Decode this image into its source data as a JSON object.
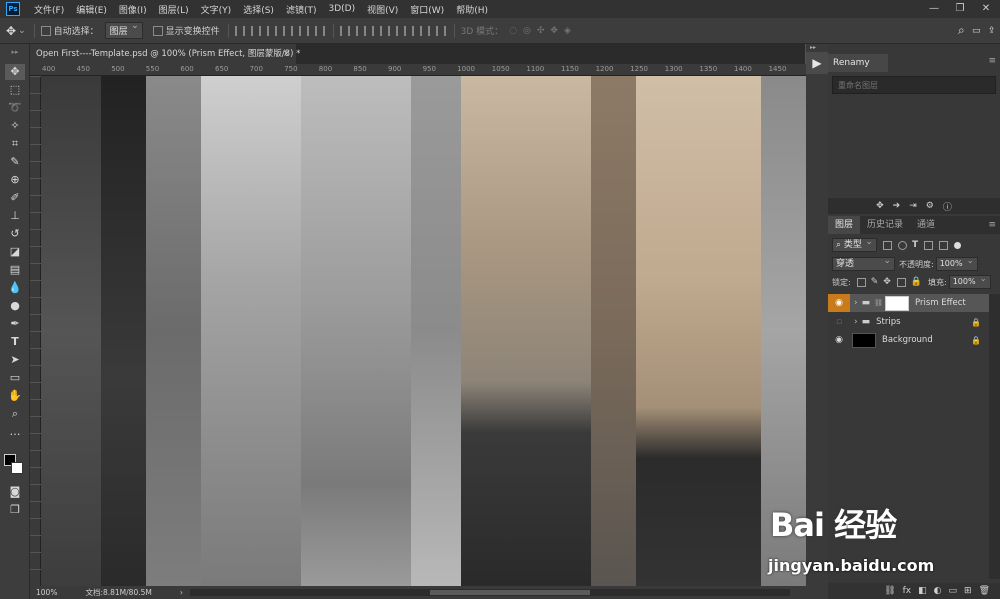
{
  "app": {
    "logo": "Ps"
  },
  "menu": [
    "文件(F)",
    "编辑(E)",
    "图像(I)",
    "图层(L)",
    "文字(Y)",
    "选择(S)",
    "滤镜(T)",
    "3D(D)",
    "视图(V)",
    "窗口(W)",
    "帮助(H)"
  ],
  "window_controls": {
    "minimize": "—",
    "maximize": "❐",
    "close": "✕"
  },
  "options_bar": {
    "move_icon": "✥",
    "auto_select_label": "自动选择：",
    "auto_select_value": "图层",
    "transform_controls_label": "显示变换控件",
    "mode_3d_label": "3D 模式：",
    "search_icon": "⌕",
    "workspace_icon": "▭",
    "share_icon": "⇪"
  },
  "document_tab": {
    "title": "Open First----Template.psd @ 100% (Prism Effect, 图层蒙版/8) *",
    "close": "×"
  },
  "ruler": {
    "h_labels": [
      "400",
      "450",
      "500",
      "550",
      "600",
      "650",
      "700",
      "750",
      "800",
      "850",
      "900",
      "950",
      "1000",
      "1050",
      "1100",
      "1150",
      "1200",
      "1250",
      "1300",
      "1350",
      "1400",
      "1450"
    ]
  },
  "status": {
    "zoom": "100%",
    "doc_info": "文档:8.81M/80.5M",
    "arrow": "›"
  },
  "dock": {
    "play_icon": "▶",
    "collapse_icon": "▸▸"
  },
  "renamy": {
    "tab": "Renamy",
    "menu_icon": "≡",
    "placeholder": "重命名图层"
  },
  "layers_panel": {
    "tabs": [
      "图层",
      "历史记录",
      "通道"
    ],
    "menu_icon": "≡",
    "filter_label": "类型",
    "blend_mode": "穿透",
    "opacity_label": "不透明度:",
    "opacity_value": "100%",
    "lock_label": "锁定:",
    "fill_label": "填充:",
    "fill_value": "100%",
    "layers": [
      {
        "name": "Prism Effect",
        "selected": true
      },
      {
        "name": "Strips",
        "selected": false
      },
      {
        "name": "Background",
        "selected": false
      }
    ],
    "bottom_icons": [
      "⛓",
      "fx",
      "◧",
      "◐",
      "▭",
      "⊞",
      "🗑"
    ]
  },
  "watermark": {
    "text": "Bai 经验",
    "url": "jingyan.baidu.com"
  }
}
